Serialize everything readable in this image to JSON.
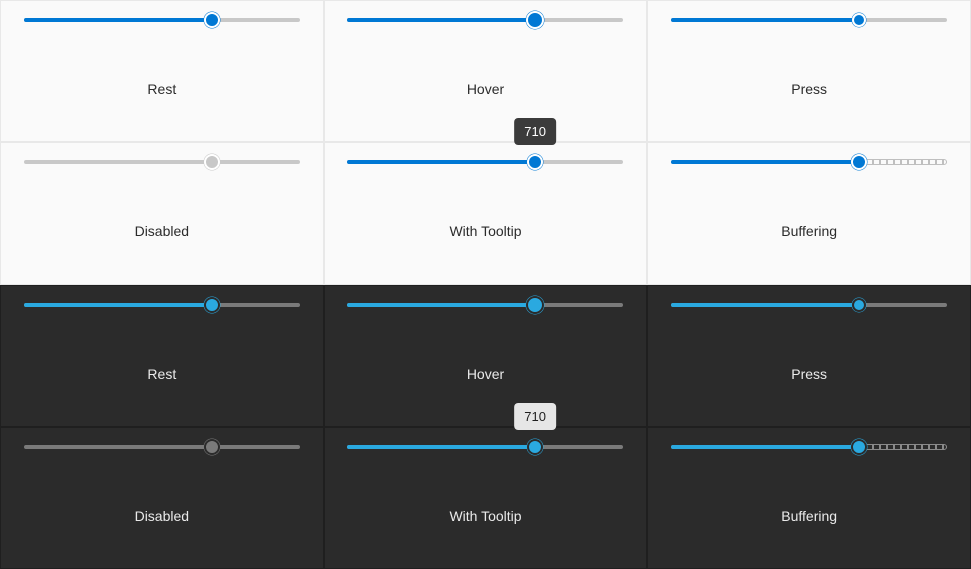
{
  "colors": {
    "light_accent": "#0078d4",
    "dark_accent": "#2aa9e0",
    "light_bg": "#fafafa",
    "dark_bg": "#2b2b2b",
    "light_track": "#c8c8c8",
    "dark_track": "#7a7a7a"
  },
  "slider": {
    "min": 0,
    "max": 1000,
    "value": 710,
    "fill_pct": 68,
    "tooltip_value": "710",
    "buffer_start_pct": 68,
    "buffer_end_pct": 100
  },
  "states": {
    "rest": {
      "label": "Rest",
      "thumb_class": "",
      "show_tooltip": false,
      "show_buffer": false,
      "disabled": false
    },
    "hover": {
      "label": "Hover",
      "thumb_class": "hover",
      "show_tooltip": false,
      "show_buffer": false,
      "disabled": false
    },
    "press": {
      "label": "Press",
      "thumb_class": "press",
      "show_tooltip": false,
      "show_buffer": false,
      "disabled": false
    },
    "disabled": {
      "label": "Disabled",
      "thumb_class": "disabled",
      "show_tooltip": false,
      "show_buffer": false,
      "disabled": true
    },
    "tooltip": {
      "label": "With Tooltip",
      "thumb_class": "",
      "show_tooltip": true,
      "show_buffer": false,
      "disabled": false
    },
    "buffering": {
      "label": "Buffering",
      "thumb_class": "",
      "show_tooltip": false,
      "show_buffer": true,
      "disabled": false
    }
  },
  "layout": {
    "themes": [
      "light",
      "dark"
    ],
    "rows": [
      [
        "rest",
        "hover",
        "press"
      ],
      [
        "disabled",
        "tooltip",
        "buffering"
      ]
    ]
  }
}
